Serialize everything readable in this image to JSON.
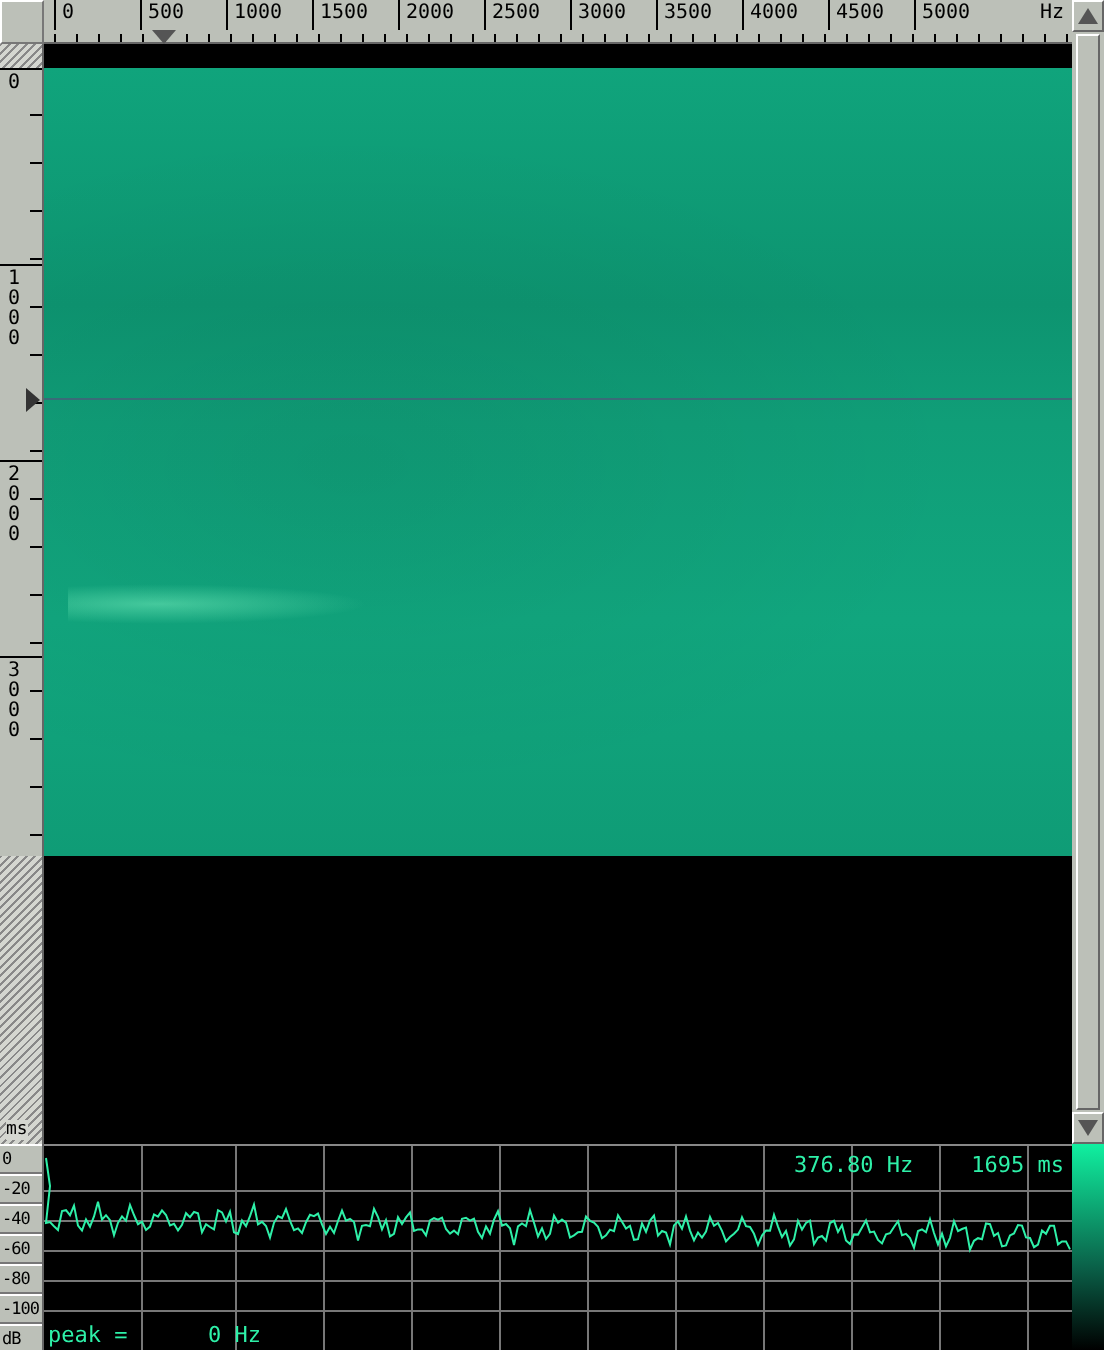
{
  "frequency_ruler": {
    "labels": [
      "0",
      "500",
      "1000",
      "1500",
      "2000",
      "2500",
      "3000",
      "3500",
      "4000",
      "4500",
      "5000"
    ],
    "unit": "Hz"
  },
  "time_ruler": {
    "labels": [
      "0",
      "1000",
      "2000",
      "3000"
    ],
    "unit": "ms"
  },
  "spectrum": {
    "y_labels": [
      "0",
      "-20",
      "-40",
      "-60",
      "-80",
      "-100"
    ],
    "y_unit": "dB",
    "frequency_readout": "376.80 Hz",
    "time_readout": "1695 ms",
    "peak_label": "peak =",
    "peak_value": "0 Hz"
  }
}
